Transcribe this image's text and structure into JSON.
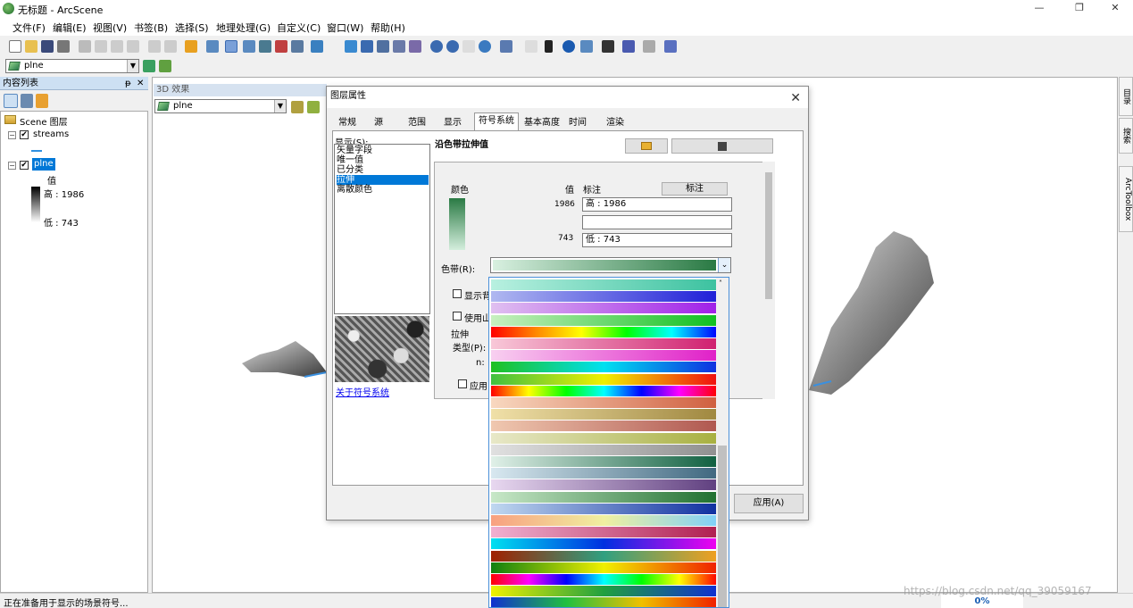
{
  "window": {
    "title": "无标题 - ArcScene",
    "min": "—",
    "restore": "❐",
    "close": "✕"
  },
  "menu": [
    "文件(F)",
    "编辑(E)",
    "视图(V)",
    "书签(B)",
    "选择(S)",
    "地理处理(G)",
    "自定义(C)",
    "窗口(W)",
    "帮助(H)"
  ],
  "toolbar2": {
    "layer_combo": "plne"
  },
  "toc": {
    "title": "内容列表",
    "pin": "ᵽ",
    "close": "✕",
    "scene_label": "Scene 图层",
    "layers": [
      {
        "name": "streams",
        "checked": "✔"
      },
      {
        "name": "plne",
        "checked": "✔"
      }
    ],
    "value_label": "值",
    "high_label": "高 : 1986",
    "low_label": "低 : 743"
  },
  "effects": {
    "title": "3D 效果",
    "layer_combo": "plne"
  },
  "dialog": {
    "title": "图层属性",
    "close": "✕",
    "tabs": [
      "常规",
      "源",
      "范围",
      "显示",
      "符号系统",
      "基本高度",
      "时间",
      "渲染"
    ],
    "active_tab": "符号系统",
    "show_label": "显示(S):",
    "show_items": [
      "矢量字段",
      "唯一值",
      "已分类",
      "拉伸",
      "离散颜色"
    ],
    "selected_show": "拉伸",
    "about_link": "关于符号系统",
    "heading": "沿色带拉伸值",
    "col_color": "颜色",
    "col_value": "值",
    "col_label": "标注",
    "label_button": "标注",
    "high_value": "1986",
    "low_value": "743",
    "high_label": "高 : 1986",
    "mid_label": "",
    "low_label": "低 : 743",
    "ramp_label": "色带(R):",
    "show_bg_label": "显示背",
    "use_hill_label": "使用山",
    "stretch_group": "拉伸",
    "type_label": "类型(P):",
    "n_label": "n:",
    "apply_label": "应用",
    "apply_button": "应用(A)"
  },
  "status": {
    "text": "正在准备用于显示的场景符号...",
    "progress": "0%"
  },
  "side_tabs": [
    "目录",
    "搜索",
    "ArcToolbox"
  ],
  "watermark": "https://blog.csdn.net/qq_39059167",
  "ramps": [
    "linear-gradient(90deg,#b8f0e0,#3cc2a0)",
    "linear-gradient(90deg,#b0b8f0,#2020d8)",
    "linear-gradient(90deg,#e0c0f0,#a020e8)",
    "linear-gradient(90deg,#c8f0c0,#10c020)",
    "linear-gradient(90deg,#f00,#f80,#ff0,#0f0,#0ff,#00f)",
    "linear-gradient(90deg,#f8c8d8,#d02070)",
    "linear-gradient(90deg,#f8d0f0,#e020c8)",
    "linear-gradient(90deg,#20c020,#00e0f0,#1030e0)",
    "linear-gradient(90deg,#40c040,#f0f000,#f01010)",
    "linear-gradient(90deg,#f00,#ff0,#0f0,#0ff,#00f,#f0f,#f00)",
    "linear-gradient(90deg,#f8d8c0,#d06040)",
    "linear-gradient(90deg,#f0e0a8,#a08840)",
    "linear-gradient(90deg,#f0c8b0,#b05850)",
    "linear-gradient(90deg,#e8e8c8,#a8b040)",
    "linear-gradient(90deg,#e0e0e0,#909090)",
    "linear-gradient(90deg,#e0f0e8,#106040)",
    "linear-gradient(90deg,#d8e8f0,#406880)",
    "linear-gradient(90deg,#e8d8f0,#604080)",
    "linear-gradient(90deg,#c8e8c8,#207030)",
    "linear-gradient(90deg,#c0d8f0,#1030a0)",
    "linear-gradient(90deg,#f8a080,#f0f0a0,#80d0f8)",
    "linear-gradient(90deg,#f0b0d0,#b02050)",
    "linear-gradient(90deg,#00e0f0,#0030e0,#f000f0)",
    "linear-gradient(90deg,#a02000,#30a080,#f0a020)",
    "linear-gradient(90deg,#108010,#f0f000,#f02000)",
    "linear-gradient(90deg,#f00,#f0f,#00f,#0ff,#0f0,#ff0,#f00)",
    "linear-gradient(90deg,#f0f000,#20a040,#1030d0)",
    "linear-gradient(90deg,#1030d0,#20c040,#f0c000,#f02000)"
  ]
}
